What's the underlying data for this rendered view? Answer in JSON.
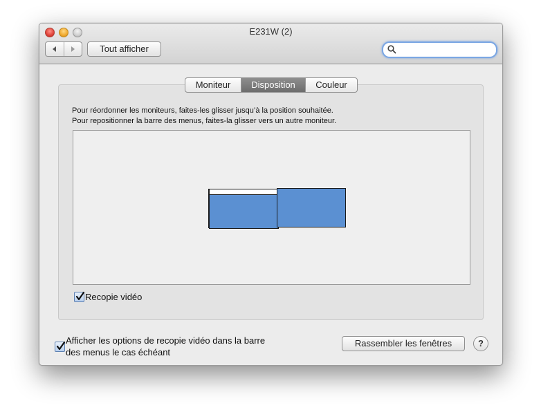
{
  "window": {
    "title": "E231W (2)"
  },
  "toolbar": {
    "show_all_label": "Tout afficher",
    "search_placeholder": ""
  },
  "tabs": [
    {
      "label": "Moniteur",
      "selected": false
    },
    {
      "label": "Disposition",
      "selected": true
    },
    {
      "label": "Couleur",
      "selected": false
    }
  ],
  "instructions": {
    "line1": "Pour réordonner les moniteurs, faites-les glisser jusqu’à la position souhaitée.",
    "line2": "Pour repositionner la barre des menus, faites-la glisser vers un autre moniteur."
  },
  "mirror": {
    "label": "Recopie vidéo",
    "checked": true
  },
  "menubar_option": {
    "line1": "Afficher les options de recopie vidéo dans la barre",
    "line2": "des menus le cas échéant",
    "checked": true
  },
  "gather_button": "Rassembler les fenêtres",
  "help_button": "?",
  "colors": {
    "monitor": "#5b90d2",
    "selected_tab": "#7d7d7d",
    "search_focus": "#7aa6e3"
  },
  "icons": [
    "back-arrow-icon",
    "forward-arrow-icon",
    "search-icon",
    "checkmark-icon"
  ]
}
